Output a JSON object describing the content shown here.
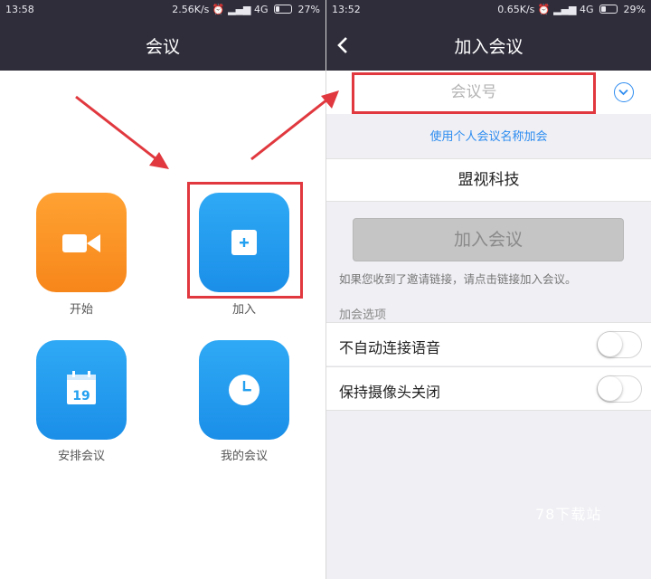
{
  "left_screen": {
    "status_bar": {
      "time": "13:58",
      "network_speed": "2.56K/s",
      "network": "4G",
      "battery": "27%",
      "battery_level": 0.27
    },
    "title": "会议",
    "tiles": [
      {
        "label": "开始",
        "icon": "video-camera-icon",
        "color": "#f7931f"
      },
      {
        "label": "加入",
        "icon": "plus-icon",
        "color": "#24a0f0"
      },
      {
        "label": "安排会议",
        "icon": "calendar-icon",
        "icon_text": "19",
        "color": "#24a0f0"
      },
      {
        "label": "我的会议",
        "icon": "clock-icon",
        "color": "#24a0f0"
      }
    ]
  },
  "right_screen": {
    "status_bar": {
      "time": "13:52",
      "network_speed": "0.65K/s",
      "network": "4G",
      "battery": "29%",
      "battery_level": 0.29
    },
    "title": "加入会议",
    "back_icon": "chevron-left-icon",
    "meeting_id_placeholder": "会议号",
    "dropdown_icon": "chevron-down-icon",
    "personal_name_link": "使用个人会议名称加会",
    "display_name": "盟视科技",
    "join_button": "加入会议",
    "hint": "如果您收到了邀请链接，请点击链接加入会议。",
    "options_header": "加会选项",
    "options": [
      {
        "label": "不自动连接语音",
        "enabled": false
      },
      {
        "label": "保持摄像头关闭",
        "enabled": false
      }
    ]
  },
  "annotations": {
    "highlight_color": "#e0383e"
  },
  "watermark": "78下载站",
  "colors": {
    "header": "#2f2d3a",
    "accent": "#2d8cf0",
    "orange": "#f7931f",
    "blue": "#24a0f0"
  }
}
